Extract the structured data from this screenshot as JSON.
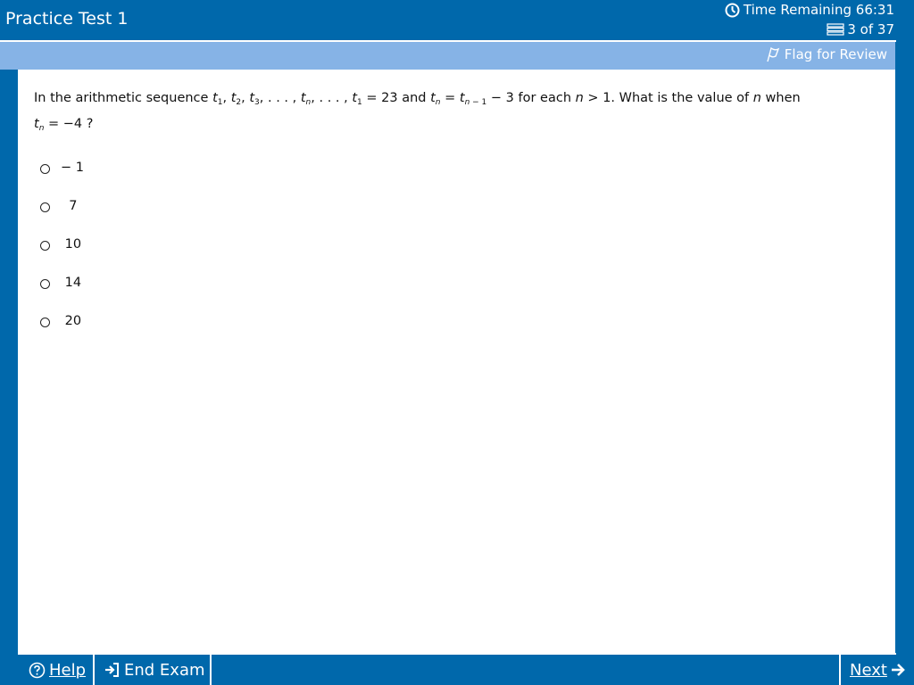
{
  "header": {
    "title": "Practice Test 1",
    "time_label": "Time Remaining 66:31",
    "progress": "3 of 37"
  },
  "flag": {
    "label": "Flag for Review"
  },
  "question": {
    "text_intro": "In the arithmetic sequence ",
    "text_mid_1": " = 23 and ",
    "text_mid_2": " − 3 for each ",
    "text_mid_3": " > 1.  What is the value of ",
    "text_mid_4": " when",
    "text_end": " = −4 ?"
  },
  "choices": [
    {
      "label": "− 1"
    },
    {
      "label": "  7"
    },
    {
      "label": " 10"
    },
    {
      "label": " 14"
    },
    {
      "label": " 20"
    }
  ],
  "footer": {
    "help_label": "Help",
    "end_exam_label": "End Exam",
    "next_label": "Next"
  },
  "icons": {
    "clock": "clock-icon",
    "progress": "questions-icon",
    "flag": "flag-icon",
    "help": "help-icon",
    "end_exam": "end-exam-icon",
    "next": "arrow-right-icon"
  },
  "colors": {
    "primary": "#0068ab",
    "flag_bar": "#86b3e6",
    "content_bg": "#ffffff"
  }
}
